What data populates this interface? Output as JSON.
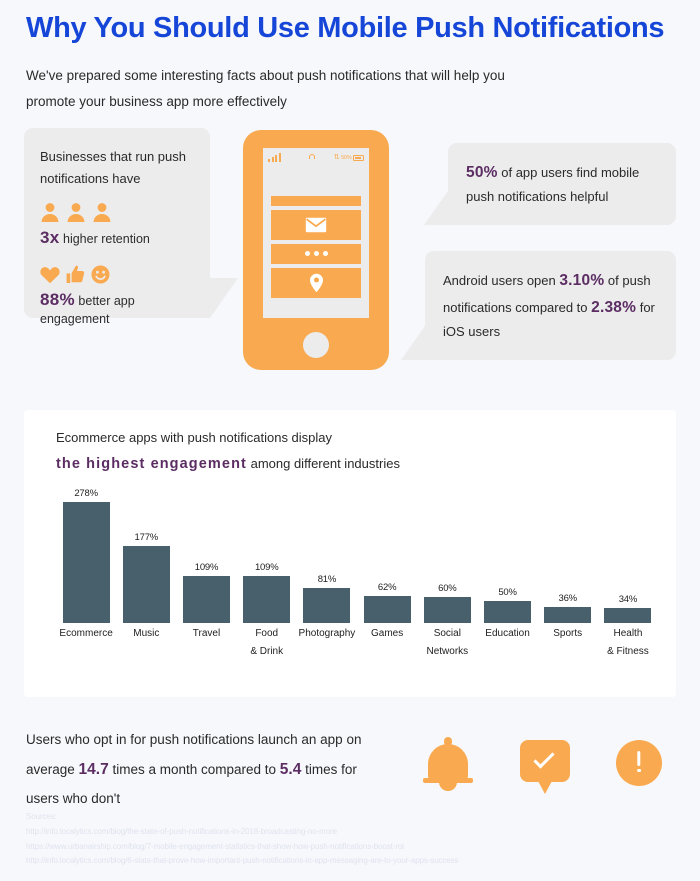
{
  "header": {
    "title": "Why You Should Use Mobile Push Notifications",
    "subtitle": "We've prepared some interesting facts about push notifications that will help you promote your business app more effectively"
  },
  "colors": {
    "title_blue": "#1546d8",
    "accent_purple": "#5b2d63",
    "accent_orange": "#f9a94f",
    "bar_slate": "#48606c",
    "bubble_gray": "#ececec",
    "page_bg": "#f7f8fc",
    "card_white": "#ffffff",
    "sources_gray": "#dfe3ef"
  },
  "left_bubble": {
    "lead": "Businesses that run push notifications have",
    "stat1_value": "3x",
    "stat1_label": "higher retention",
    "stat2_value": "88%",
    "stat2_label": "better app engagement",
    "icons_row1": [
      "person-icon",
      "person-icon",
      "person-icon"
    ],
    "icons_row2": [
      "heart-icon",
      "thumbs-up-icon",
      "smiley-icon"
    ]
  },
  "right_bubbles": [
    {
      "value": "50%",
      "text_after": " of app users find mobile push notifications helpful"
    },
    {
      "prefix": "Android users open ",
      "value1": "3.10%",
      "middle": " of push notifications compared to ",
      "value2": "2.38%",
      "suffix": " for iOS users"
    }
  ],
  "phone": {
    "status_bar": {
      "signal": "signal-bars-icon",
      "lock": "lock-icon",
      "bluetooth": "bluetooth-icon",
      "battery_percent": "50%",
      "battery": "battery-icon"
    },
    "notifications": [
      {
        "icon": "bar-placeholder"
      },
      {
        "icon": "envelope-icon"
      },
      {
        "icon": "ellipsis-icon"
      },
      {
        "icon": "location-pin-icon"
      }
    ],
    "home_button": "home-button"
  },
  "chart_card": {
    "headline_part1": "Ecommerce apps with push notifications display",
    "headline_highlight": "the highest engagement",
    "headline_part2": " among different industries"
  },
  "chart_data": {
    "type": "bar",
    "title": "Ecommerce apps with push notifications display the highest engagement among different industries",
    "categories": [
      "Ecommerce",
      "Music",
      "Travel",
      "Food\n& Drink",
      "Photography",
      "Games",
      "Social\nNetworks",
      "Education",
      "Sports",
      "Health\n& Fitness"
    ],
    "category_lines": [
      [
        "Ecommerce"
      ],
      [
        "Music"
      ],
      [
        "Travel"
      ],
      [
        "Food",
        "& Drink"
      ],
      [
        "Photography"
      ],
      [
        "Games"
      ],
      [
        "Social",
        "Networks"
      ],
      [
        "Education"
      ],
      [
        "Sports"
      ],
      [
        "Health",
        "& Fitness"
      ]
    ],
    "values": [
      278,
      177,
      109,
      109,
      81,
      62,
      60,
      50,
      36,
      34
    ],
    "value_labels": [
      "278%",
      "177%",
      "109%",
      "109%",
      "81%",
      "62%",
      "60%",
      "50%",
      "36%",
      "34%"
    ],
    "xlabel": "",
    "ylabel": "",
    "ylim": [
      0,
      278
    ],
    "grid": false,
    "legend": false,
    "bar_color": "#48606c"
  },
  "bottom": {
    "part1": "Users who opt in for push notifications launch an app on average ",
    "value1": "14.7",
    "part2": " times a month compared to ",
    "value2": "5.4",
    "part3": " times for users who don't",
    "icons": [
      "bell-icon",
      "speech-bubble-check-icon",
      "exclamation-circle-icon"
    ]
  },
  "sources": {
    "label": "Sources:",
    "urls": [
      "http://info.localytics.com/blog/the-state-of-push-notifications-in-2018-broadcasting-no-more",
      "https://www.urbanairship.com/blog/7-mobile-engagement-statistics-that-show-how-push-notifications-boost-roi",
      "http://info.localytics.com/blog/6-stats-that-prove-how-important-push-notifications-in-app-messaging-are-to-your-apps-success"
    ]
  }
}
